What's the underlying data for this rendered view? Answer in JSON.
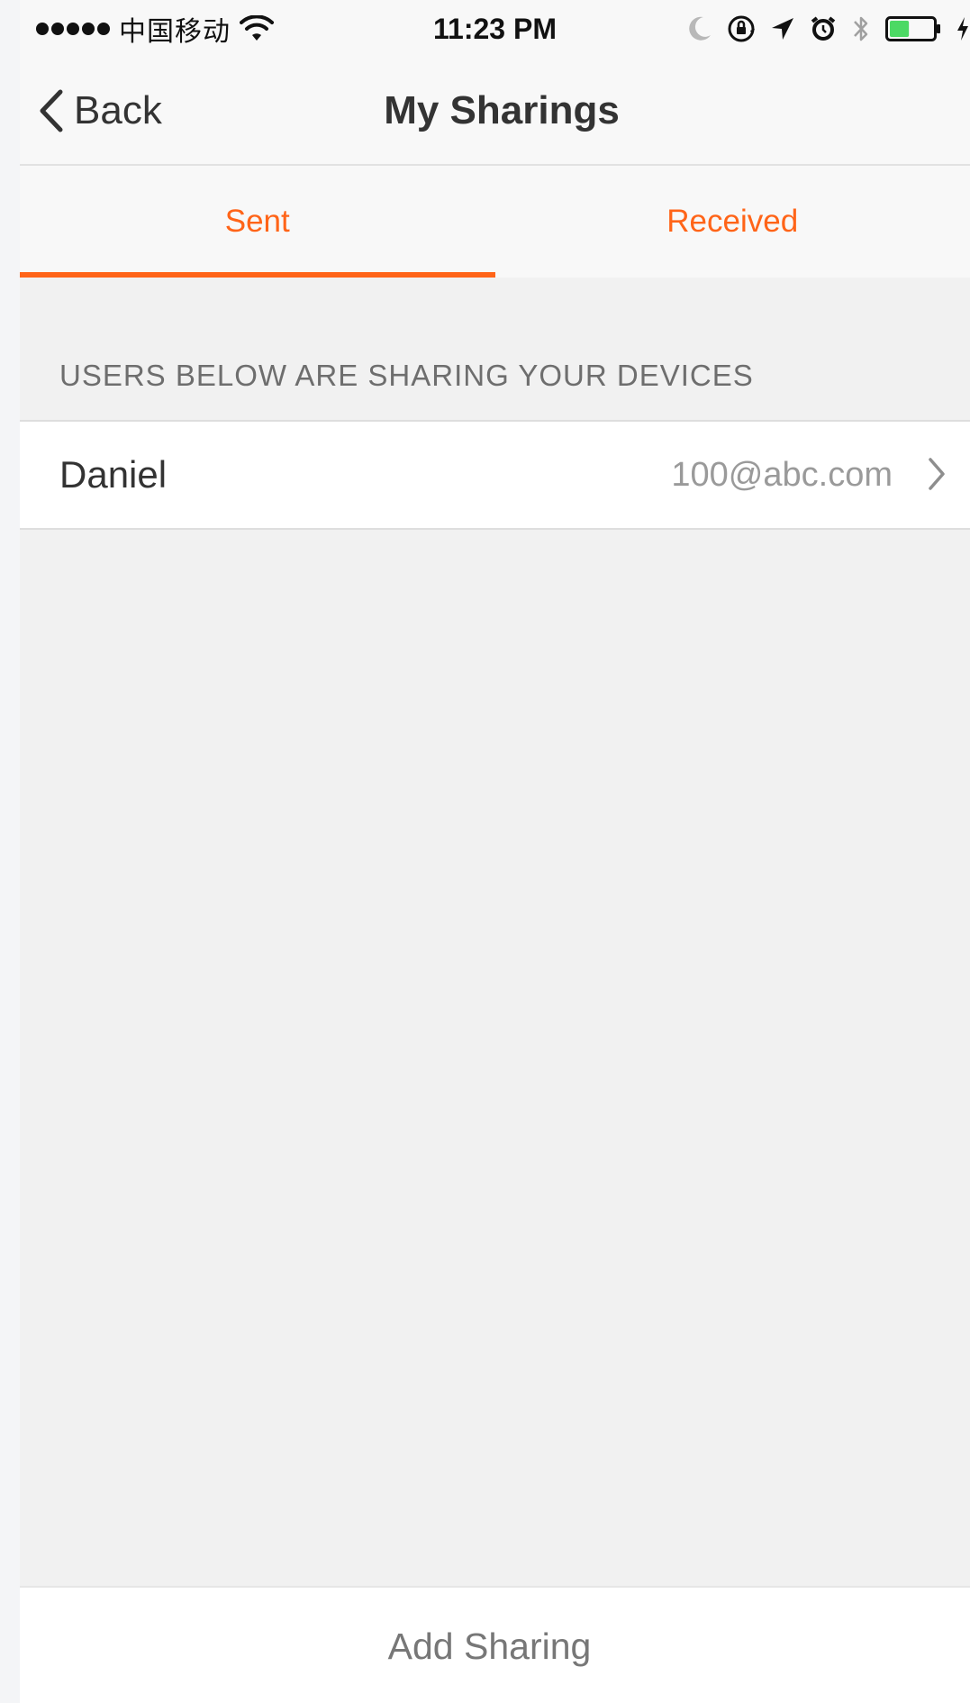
{
  "status_bar": {
    "carrier": "中国移动",
    "time": "11:23 PM",
    "icons": [
      "signal-dots-icon",
      "wifi-icon",
      "moon-icon",
      "orientation-lock-icon",
      "location-arrow-icon",
      "alarm-icon",
      "bluetooth-icon",
      "battery-icon",
      "charging-bolt-icon"
    ],
    "battery_level": 0.45,
    "battery_color": "#4cd964"
  },
  "nav": {
    "back_label": "Back",
    "title": "My Sharings"
  },
  "tabs": [
    {
      "label": "Sent",
      "active": true
    },
    {
      "label": "Received",
      "active": false
    }
  ],
  "accent_color": "#ff6418",
  "section": {
    "header": "USERS BELOW ARE SHARING YOUR DEVICES"
  },
  "list": {
    "items": [
      {
        "name": "Daniel",
        "email": "100@abc.com"
      }
    ]
  },
  "bottom": {
    "add_sharing_label": "Add Sharing"
  }
}
